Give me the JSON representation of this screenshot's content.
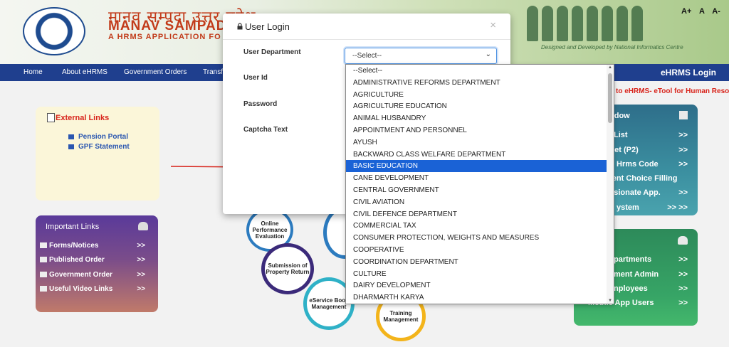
{
  "header": {
    "hindi_title": "मानव सम्पदा उत्तर प्रदेश",
    "brand": "MANAV SAMPADA",
    "tagline": "A HRMS APPLICATION FO",
    "nic_text": "Designed and Developed by National Informatics Centre",
    "font_controls": "A+ A A-"
  },
  "nav": {
    "items": [
      "Home",
      "About eHRMS",
      "Government Orders",
      "Transf"
    ],
    "login": "eHRMS Login"
  },
  "ticker": "to eHRMS- eTool for Human Reso",
  "external_links": {
    "title": "External Links",
    "items": [
      "Pension Portal",
      "GPF Statement"
    ]
  },
  "important_links": {
    "title": "Important Links",
    "items": [
      {
        "label": "Forms/Notices",
        "arrow": ">>"
      },
      {
        "label": "Published Order",
        "arrow": ">>"
      },
      {
        "label": "Government Order",
        "arrow": ">>"
      },
      {
        "label": "Useful Video Links",
        "arrow": ">>"
      }
    ]
  },
  "diagram": {
    "c1": "Online Performance Evaluation",
    "c2": "Submission of Property Return",
    "c3": "eService Book Management",
    "c4": "Training Management"
  },
  "right_box_1": {
    "title": "ndow",
    "items": [
      {
        "label": "List",
        "arrow": ">>"
      },
      {
        "label": "eet (P2)",
        "arrow": ">>"
      },
      {
        "label": "Hrms Code",
        "arrow": ">>"
      },
      {
        "label": "ment Choice Filling",
        "arrow": ""
      },
      {
        "label": "assionate App.",
        "arrow": ">>"
      },
      {
        "label": "ystem",
        "arrow": ">>  >>"
      }
    ]
  },
  "right_box_2": {
    "items": [
      {
        "label": "partments",
        "arrow": ">>"
      },
      {
        "label": "ment Admin",
        "arrow": ">>"
      },
      {
        "label": "nployees",
        "arrow": ">>"
      },
      {
        "label": "Mobile App Users",
        "arrow": ">>"
      }
    ]
  },
  "modal": {
    "title": "User Login",
    "close": "×",
    "labels": {
      "department": "User Department",
      "user_id": "User Id",
      "password": "Password",
      "captcha": "Captcha Text"
    },
    "select_value": "--Select--"
  },
  "dropdown": {
    "selected_index": 8,
    "options": [
      "--Select--",
      "ADMINISTRATIVE REFORMS DEPARTMENT",
      "AGRICULTURE",
      "AGRICULTURE EDUCATION",
      "ANIMAL HUSBANDRY",
      "APPOINTMENT AND PERSONNEL",
      "AYUSH",
      "BACKWARD CLASS WELFARE DEPARTMENT",
      "BASIC EDUCATION",
      "CANE DEVELOPMENT",
      "CENTRAL GOVERNMENT",
      "CIVIL AVIATION",
      "CIVIL DEFENCE DEPARTMENT",
      "COMMERCIAL TAX",
      "CONSUMER PROTECTION, WEIGHTS AND MEASURES",
      "COOPERATIVE",
      "COORDINATION DEPARTMENT",
      "CULTURE",
      "DAIRY DEVELOPMENT",
      "DHARMARTH KARYA"
    ]
  },
  "colors": {
    "nav": "#1f3f8e",
    "brand": "#c23b1a",
    "selected_option": "#1a62d6",
    "annotation_arrow": "#d8241b"
  }
}
